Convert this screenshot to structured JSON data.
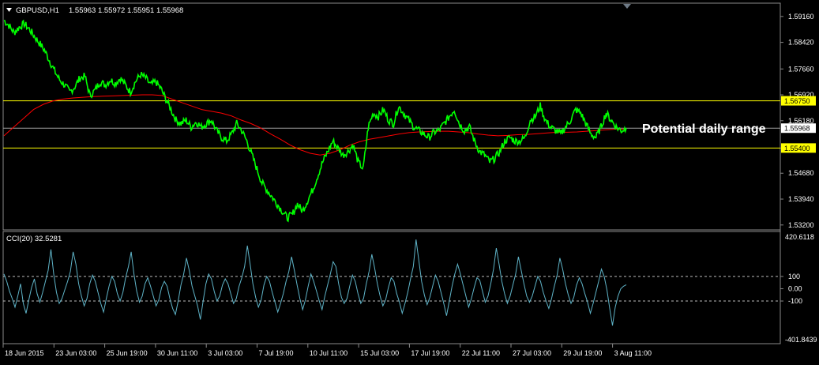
{
  "header": {
    "menu_arrow_icon": "triangle-down-icon",
    "symbol_timeframe": "GBPUSD,H1",
    "ohlc": "1.55963 1.55972 1.55951 1.55968"
  },
  "colors": {
    "background": "#000000",
    "price": "#00FF00",
    "moving_average": "#FF0000",
    "level_lines": "#FFFF00",
    "current_price_line": "#A0A0A0",
    "cci": "#5FB4C8",
    "grid_text": "#FFFFFF"
  },
  "annotation": "Potential daily range",
  "cci_panel": {
    "title": "CCI(20) 32.5281",
    "max_label": "420.6118",
    "min_label": "-401.8439"
  },
  "chart_data": [
    {
      "type": "line",
      "name_label": "GBPUSD,H1",
      "y_ticks": [
        "1.59160",
        "1.58420",
        "1.57660",
        "1.56920",
        "1.56180",
        "1.55400",
        "1.54680",
        "1.53940",
        "1.53200"
      ],
      "ylim": [
        1.5315,
        1.5945
      ],
      "levels": [
        {
          "value": 1.5675,
          "label": "1.56750",
          "highlight": true
        },
        {
          "value": 1.554,
          "label": "1.55400",
          "highlight": true
        },
        {
          "value": 1.55968,
          "label": "1.55968",
          "highlight": false
        }
      ],
      "price_series": [
        1.5905,
        1.589,
        1.587,
        1.5885,
        1.5895,
        1.588,
        1.586,
        1.584,
        1.582,
        1.579,
        1.576,
        1.5735,
        1.572,
        1.57,
        1.5715,
        1.574,
        1.5745,
        1.569,
        1.5705,
        1.573,
        1.572,
        1.5735,
        1.5725,
        1.574,
        1.572,
        1.57,
        1.573,
        1.575,
        1.574,
        1.572,
        1.573,
        1.571,
        1.568,
        1.565,
        1.562,
        1.561,
        1.562,
        1.56,
        1.5615,
        1.56,
        1.561,
        1.562,
        1.559,
        1.557,
        1.556,
        1.558,
        1.561,
        1.559,
        1.556,
        1.552,
        1.548,
        1.544,
        1.542,
        1.54,
        1.538,
        1.536,
        1.534,
        1.535,
        1.538,
        1.536,
        1.539,
        1.542,
        1.546,
        1.55,
        1.553,
        1.556,
        1.554,
        1.552,
        1.553,
        1.555,
        1.55,
        1.548,
        1.56,
        1.564,
        1.563,
        1.565,
        1.562,
        1.561,
        1.566,
        1.564,
        1.562,
        1.56,
        1.559,
        1.558,
        1.557,
        1.5585,
        1.559,
        1.561,
        1.563,
        1.565,
        1.561,
        1.559,
        1.56,
        1.556,
        1.553,
        1.552,
        1.55,
        1.551,
        1.553,
        1.556,
        1.557,
        1.556,
        1.556,
        1.557,
        1.562,
        1.563,
        1.566,
        1.562,
        1.56,
        1.559,
        1.558,
        1.56,
        1.562,
        1.565,
        1.564,
        1.561,
        1.558,
        1.557,
        1.56,
        1.564,
        1.562,
        1.56,
        1.559,
        1.5597
      ],
      "ma_series": [
        1.5575,
        1.56,
        1.5625,
        1.565,
        1.5665,
        1.5675,
        1.568,
        1.5683,
        1.5685,
        1.5687,
        1.5688,
        1.5689,
        1.569,
        1.5691,
        1.5692,
        1.5692,
        1.569,
        1.568,
        1.567,
        1.566,
        1.565,
        1.5645,
        1.564,
        1.5632,
        1.562,
        1.561,
        1.5597,
        1.558,
        1.5565,
        1.5548,
        1.5535,
        1.5525,
        1.552,
        1.5525,
        1.5535,
        1.5548,
        1.5558,
        1.5565,
        1.557,
        1.5575,
        1.558,
        1.5584,
        1.5586,
        1.5587,
        1.5588,
        1.5588,
        1.5586,
        1.5584,
        1.558,
        1.5577,
        1.5575,
        1.5576,
        1.5578,
        1.5579,
        1.5581,
        1.5583,
        1.5585,
        1.5585,
        1.5586,
        1.5588,
        1.559,
        1.5592,
        1.5594,
        1.5594
      ]
    },
    {
      "type": "line",
      "name_label": "CCI(20)",
      "y_ticks": [
        "100",
        "0.00",
        "-100"
      ],
      "ylim": [
        -401.8439,
        420.6118
      ],
      "reference_levels": [
        100,
        0,
        -100
      ],
      "cci_series": [
        120,
        60,
        -20,
        -80,
        -150,
        -60,
        40,
        -120,
        -200,
        -90,
        10,
        80,
        -40,
        -110,
        -30,
        60,
        150,
        320,
        120,
        -30,
        -120,
        -80,
        -10,
        60,
        140,
        300,
        200,
        40,
        -60,
        -140,
        -80,
        40,
        110,
        60,
        -30,
        -120,
        -190,
        -80,
        20,
        100,
        60,
        -40,
        -100,
        -30,
        90,
        180,
        300,
        120,
        -20,
        -110,
        -60,
        40,
        90,
        20,
        -60,
        -140,
        -90,
        10,
        60,
        20,
        -80,
        -160,
        -210,
        -100,
        30,
        120,
        250,
        150,
        20,
        -60,
        -140,
        -250,
        -100,
        40,
        120,
        80,
        -20,
        -100,
        -60,
        30,
        80,
        40,
        -40,
        -120,
        -80,
        20,
        90,
        180,
        350,
        200,
        40,
        -70,
        -150,
        -90,
        30,
        100,
        60,
        -30,
        -110,
        -190,
        -120,
        -40,
        60,
        140,
        260,
        150,
        30,
        -80,
        -170,
        -90,
        20,
        120,
        60,
        -20,
        -100,
        -170,
        -60,
        30,
        120,
        220,
        180,
        40,
        -70,
        -120,
        -80,
        20,
        110,
        60,
        -40,
        -120,
        -80,
        40,
        140,
        280,
        170,
        40,
        -60,
        -140,
        -90,
        10,
        90,
        60,
        -40,
        -110,
        -200,
        -120,
        -30,
        80,
        180,
        400,
        230,
        60,
        -50,
        -130,
        -70,
        20,
        110,
        60,
        -30,
        -120,
        -220,
        -100,
        20,
        120,
        200,
        120,
        30,
        -60,
        -150,
        -80,
        10,
        90,
        70,
        -20,
        -110,
        -60,
        40,
        160,
        330,
        200,
        60,
        -40,
        -120,
        -60,
        30,
        120,
        260,
        150,
        40,
        -60,
        -110,
        -60,
        20,
        100,
        60,
        -30,
        -100,
        -160,
        -80,
        20,
        110,
        250,
        160,
        40,
        -50,
        -120,
        -70,
        30,
        90,
        40,
        -40,
        -110,
        -200,
        -120,
        -30,
        60,
        160,
        100,
        -10,
        -160,
        -300,
        -150,
        -60,
        0,
        20,
        32.53
      ],
      "y_axis_label": ""
    }
  ],
  "x_axis": {
    "labels": [
      "18 Jun 2015",
      "23 Jun 03:00",
      "25 Jun 19:00",
      "30 Jun 11:00",
      "3 Jul 03:00",
      "7 Jul 19:00",
      "10 Jul 11:00",
      "15 Jul 03:00",
      "17 Jul 19:00",
      "22 Jul 11:00",
      "27 Jul 03:00",
      "29 Jul 19:00",
      "3 Aug 11:00"
    ]
  }
}
